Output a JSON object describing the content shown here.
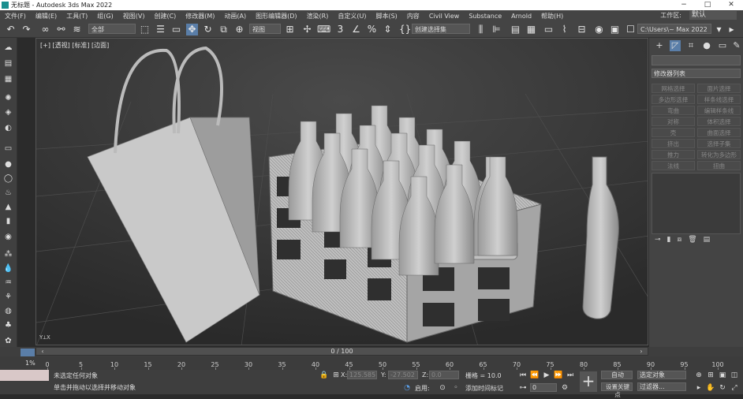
{
  "titlebar": {
    "title": "无标题 - Autodesk 3ds Max 2022",
    "minimize": "−",
    "maximize": "□",
    "close": "✕"
  },
  "menu": [
    "文件(F)",
    "编辑(E)",
    "工具(T)",
    "组(G)",
    "视图(V)",
    "创建(C)",
    "修改器(M)",
    "动画(A)",
    "图形编辑器(D)",
    "渲染(R)",
    "自定义(U)",
    "脚本(S)",
    "内容",
    "Civil View",
    "Substance",
    "Arnold",
    "帮助(H)"
  ],
  "workspace": {
    "label": "工作区:",
    "value": "默认"
  },
  "toolbar": {
    "selection_filter": "全部",
    "ref_coord": "视图",
    "named_selection": "创建选择集",
    "path": "C:\\Users\\~ Max 2022"
  },
  "viewport": {
    "label": "[+] [透视] [标准] [边面]"
  },
  "command_panel": {
    "modifier_list": "修改器列表",
    "buttons": [
      "网格选择",
      "面片选择",
      "多边形选择",
      "样条线选择",
      "弯曲",
      "编辑样条线",
      "对称",
      "体积选择",
      "壳",
      "曲面选择",
      "挤出",
      "选择子集",
      "推力",
      "转化为多边形",
      "法线",
      "扭曲"
    ]
  },
  "timeline": {
    "frame_display": "0 / 100",
    "ticks": [
      "0",
      "5",
      "10",
      "15",
      "20",
      "25",
      "30",
      "35",
      "40",
      "45",
      "50",
      "55",
      "60",
      "65",
      "70",
      "75",
      "80",
      "85",
      "90",
      "95",
      "100"
    ]
  },
  "status": {
    "script_label": "1%",
    "selection": "未选定任何对象",
    "prompt": "单击并拖动以选择并移动对象",
    "x_label": "X:",
    "x_value": "125.585",
    "y_label": "Y:",
    "y_value": "-27.502",
    "z_label": "Z:",
    "z_value": "0.0",
    "grid": "栅格 = 10.0",
    "enable": "启用:",
    "add_time_tag": "添加时间标记",
    "autokey": "自动",
    "set_key": "设置关键点",
    "selected_obj": "选定对象",
    "filters": "过滤器...",
    "frame": "0"
  }
}
